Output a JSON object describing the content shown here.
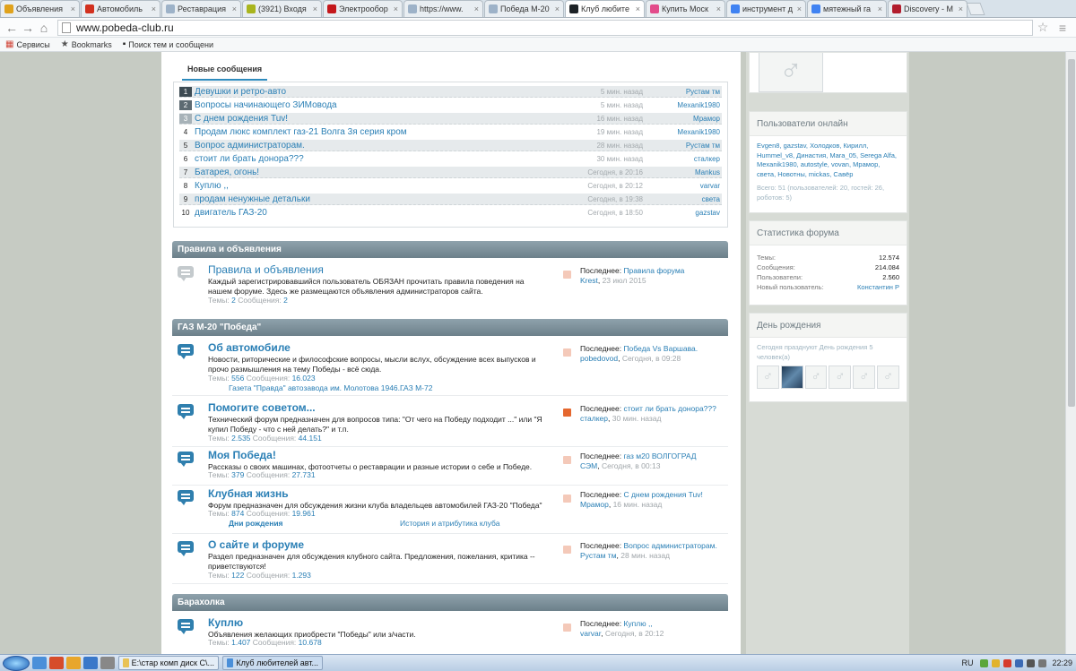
{
  "browser": {
    "tabs": [
      {
        "title": "Объявления",
        "color": "#e0a21c"
      },
      {
        "title": "Автомобиль",
        "color": "#d2311f"
      },
      {
        "title": "Реставрация",
        "color": "#9db2c8"
      },
      {
        "title": "(3921) Входя",
        "color": "#a9b51e"
      },
      {
        "title": "Электрообор",
        "color": "#c4181c"
      },
      {
        "title": "https://www.",
        "color": "#9db2c8"
      },
      {
        "title": "Победа М-20",
        "color": "#9db2c8"
      },
      {
        "title": "Клуб любите",
        "color": "#1d2226",
        "active": true
      },
      {
        "title": "Купить Моск",
        "color": "#e34c8b"
      },
      {
        "title": "инструмент д",
        "color": "#3f82f2"
      },
      {
        "title": "мятежный га",
        "color": "#3f82f2"
      },
      {
        "title": "Discovery - M",
        "color": "#b21d2d"
      }
    ],
    "url": "www.pobeda-club.ru",
    "bookmarks": [
      {
        "label": "Сервисы",
        "icon": "apps-icon"
      },
      {
        "label": "Bookmarks",
        "icon": "star-icon"
      },
      {
        "label": "Поиск тем и сообщени",
        "icon": "page-icon"
      }
    ]
  },
  "new_posts": {
    "tab_label": "Новые сообщения",
    "rows": [
      {
        "n": "1",
        "title": "Девушки и ретро-авто",
        "time": "5 мин. назад",
        "author": "Рустам тм"
      },
      {
        "n": "2",
        "title": "Вопросы начинающего ЗИМовода",
        "time": "5 мин. назад",
        "author": "Mexanik1980"
      },
      {
        "n": "3",
        "title": "С днем рождения Tuv!",
        "time": "16 мин. назад",
        "author": "Мрамор"
      },
      {
        "n": "4",
        "title": "Продам люкс комплект газ-21 Волга 3я серия кром",
        "time": "19 мин. назад",
        "author": "Mexanik1980"
      },
      {
        "n": "5",
        "title": "Вопрос администраторам.",
        "time": "28 мин. назад",
        "author": "Рустам тм"
      },
      {
        "n": "6",
        "title": "стоит ли брать донора???",
        "time": "30 мин. назад",
        "author": "сталкер"
      },
      {
        "n": "7",
        "title": "Батарея, огонь!",
        "time": "Сегодня, в 20:16",
        "author": "Mankus"
      },
      {
        "n": "8",
        "title": "Куплю ,,",
        "time": "Сегодня, в 20:12",
        "author": "varvar"
      },
      {
        "n": "9",
        "title": "продам ненужные детальки",
        "time": "Сегодня, в 19:38",
        "author": "света"
      },
      {
        "n": "10",
        "title": "двигатель ГАЗ-20",
        "time": "Сегодня, в 18:50",
        "author": "gazstav"
      }
    ]
  },
  "labels": {
    "themes": "Темы:",
    "messages": "Сообщения:",
    "last": "Последнее:"
  },
  "categories": [
    {
      "title": "Правила и объявления"
    },
    {
      "title": "ГАЗ М-20 \"Победа\""
    },
    {
      "title": "Барахолка"
    }
  ],
  "forums": [
    {
      "title": "Правила и объявления",
      "desc": "Каждый зарегистрировавшийся пользователь ОБЯЗАН прочитать правила поведения на нашем форуме. Здесь же размещаются объявления администраторов сайта.",
      "themes": "2",
      "messages": "2",
      "last_title": "Правила форума",
      "last_author": "Krest",
      "last_time": "23 июл 2015"
    },
    {
      "title": "Об автомобиле",
      "desc": "Новости, риторические и философские вопросы, мысли вслух, обсуждение всех выпусков и прочо размышления на тему Победы - всё сюда.",
      "themes": "556",
      "messages": "16.023",
      "sub": [
        "Газета \"Правда\" автозавода им. Молотова 1946...",
        "ГАЗ М-72"
      ],
      "last_title": "Победа Vs Варшава.",
      "last_author": "pobedovod",
      "last_time": "Сегодня, в 09:28"
    },
    {
      "title": "Помогите советом...",
      "desc": "Технический форум предназначен для вопросов типа: \"От чего на Победу подходит ...\" или \"Я купил Победу - что с ней делать?\" и т.п.",
      "themes": "2.535",
      "messages": "44.151",
      "last_title": "стоит ли брать донора???",
      "last_author": "сталкер",
      "last_time": "30 мин. назад"
    },
    {
      "title": "Моя Победа!",
      "desc": "Рассказы о своих машинах, фотоотчеты о реставрации и разные истории о себе и Победе.",
      "themes": "379",
      "messages": "27.731",
      "last_title": "газ м20 ВОЛГОГРАД",
      "last_author": "СЭМ",
      "last_time": "Сегодня, в 00:13"
    },
    {
      "title": "Клубная жизнь",
      "desc": "Форум предназначен для обсуждения жизни клуба владельцев автомобилей ГАЗ-20 \"Победа\"",
      "themes": "874",
      "messages": "19.961",
      "sub": [
        "Дни рождения",
        "История и атрибутика клуба"
      ],
      "last_title": "С днем рождения Tuv!",
      "last_author": "Мрамор",
      "last_time": "16 мин. назад"
    },
    {
      "title": "О сайте и форуме",
      "desc": "Раздел предназначен для обсуждения клубного сайта. Предложения, пожелания, критика -- приветствуются!",
      "themes": "122",
      "messages": "1.293",
      "last_title": "Вопрос администраторам.",
      "last_author": "Рустам тм",
      "last_time": "28 мин. назад"
    },
    {
      "title": "Куплю",
      "desc": "Объявления желающих приобрести \"Победы\" или з/части.",
      "themes": "1.407",
      "messages": "10.678",
      "last_title": "Куплю ,,",
      "last_author": "varvar",
      "last_time": "Сегодня, в 20:12"
    }
  ],
  "sidebar": {
    "online_title": "Пользователи онлайн",
    "online_users": "Evgen8, gazstav, Холодков, Кирилл, Hummel_v8, Династия, Mara_05, Serega Alfa, Mexanik1980, autostyle, vovan, Мрамор, света, Новотны, mickas, Савёр",
    "online_total": "Всего: 51 (пользователей: 20, гостей: 26, роботов: 5)",
    "stats_title": "Статистика форума",
    "stats": [
      {
        "k": "Темы:",
        "v": "12.574"
      },
      {
        "k": "Сообщения:",
        "v": "214.084"
      },
      {
        "k": "Пользователи:",
        "v": "2.560"
      },
      {
        "k": "Новый пользователь:",
        "v": "Константин Р"
      }
    ],
    "birthday_title": "День рождения",
    "birthday_text": "Сегодня празднуют День рождения 5 человек(а)",
    "avatar_glyph": "♂"
  },
  "taskbar": {
    "windows": [
      {
        "title": "E:\\стар комп диск C\\...",
        "active": false
      },
      {
        "title": "Клуб любителей авт...",
        "active": true
      }
    ],
    "lang": "RU",
    "clock": "22:29"
  }
}
